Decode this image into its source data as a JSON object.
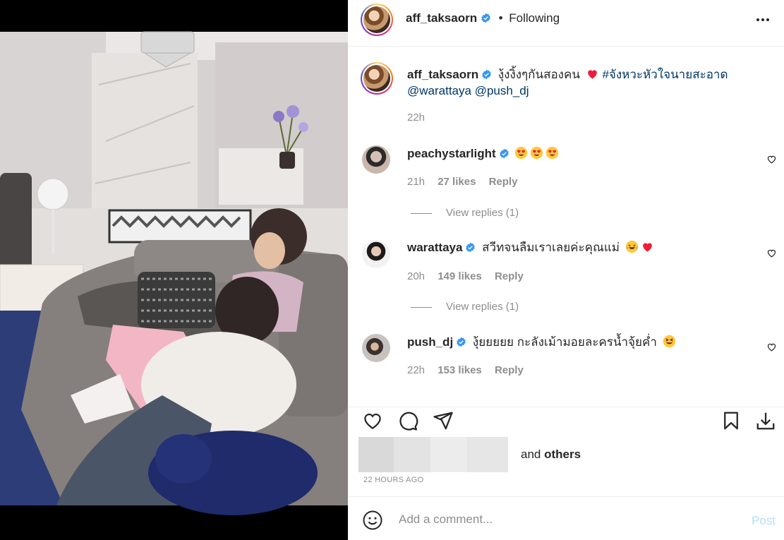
{
  "post": {
    "author": "aff_taksaorn",
    "follow_dot": "•",
    "follow_status": "Following",
    "caption_text": "งุ้งงิ้งๆกันสองคน",
    "caption_hashtag": "#จังหวะหัวใจนายสะอาด",
    "caption_mentions": "@warattaya @push_dj",
    "caption_time": "22h"
  },
  "comments": [
    {
      "username": "peachystarlight",
      "text": "",
      "emojis": [
        "heart-eyes",
        "heart-eyes",
        "heart-eyes"
      ],
      "time": "21h",
      "likes": "27 likes",
      "reply": "Reply",
      "view_replies": "View replies (1)"
    },
    {
      "username": "warattaya",
      "text": "สวีทจนลืมเราเลยค่ะคุณแม่",
      "emojis": [
        "laughing-tears",
        "red-heart"
      ],
      "time": "20h",
      "likes": "149 likes",
      "reply": "Reply",
      "view_replies": "View replies (1)"
    },
    {
      "username": "push_dj",
      "text": "งุ้ยยยยย กะลังเม้ามอยละครน้ำจุ้ยค่ำ",
      "emojis": [
        "squinting-grin"
      ],
      "time": "22h",
      "likes": "153 likes",
      "reply": "Reply"
    }
  ],
  "likes": {
    "and_text": "and",
    "others_text": "others"
  },
  "timeago": "22 HOURS AGO",
  "comment_box": {
    "placeholder": "Add a comment...",
    "post_label": "Post"
  },
  "icons": {
    "heart": "heart-icon",
    "comment": "comment-icon",
    "share": "share-icon",
    "save": "bookmark-icon",
    "download": "download-icon",
    "more": "more-options-icon",
    "emoji": "emoji-icon",
    "verified": "verified-badge-icon"
  },
  "colors": {
    "link": "#00376b",
    "muted": "#8e8e8e",
    "verified": "#3897f0",
    "post_disabled": "#b2dffc",
    "heart_red": "#ed1c3a"
  }
}
